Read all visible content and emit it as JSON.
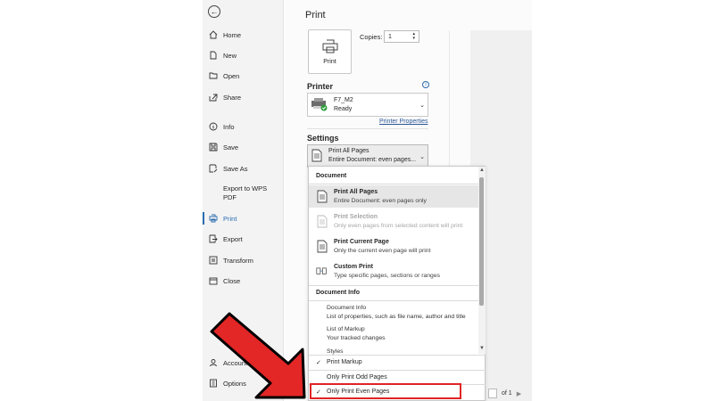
{
  "sidebar": {
    "back_label": "←",
    "items": [
      {
        "label": "Home",
        "icon": "home-icon"
      },
      {
        "label": "New",
        "icon": "new-doc-icon"
      },
      {
        "label": "Open",
        "icon": "folder-icon"
      },
      {
        "label": "Share",
        "icon": "share-icon"
      },
      {
        "label": "Info",
        "icon": "info-icon"
      },
      {
        "label": "Save",
        "icon": "save-icon"
      },
      {
        "label": "Save As",
        "icon": "save-as-icon"
      },
      {
        "label": "Export to WPS PDF",
        "line1": "Export to WPS",
        "line2": "PDF",
        "icon": ""
      },
      {
        "label": "Print",
        "icon": "printer-icon"
      },
      {
        "label": "Export",
        "icon": "export-icon"
      },
      {
        "label": "Transform",
        "icon": "transform-icon"
      },
      {
        "label": "Close",
        "icon": "close-icon"
      },
      {
        "label": "Account",
        "icon": "account-icon"
      },
      {
        "label": "Options",
        "icon": "options-icon"
      }
    ],
    "active": "Print"
  },
  "main": {
    "title": "Print",
    "print_button_label": "Print",
    "copies_label": "Copies:",
    "copies_value": "1",
    "printer_section": "Printer",
    "printer_name": "F7_M2",
    "printer_status": "Ready",
    "printer_properties_link": "Printer Properties",
    "settings_section": "Settings",
    "settings_line1": "Print All Pages",
    "settings_line2": "Entire Document: even pages..."
  },
  "dropdown": {
    "document_header": "Document",
    "items": [
      {
        "title": "Print All Pages",
        "desc": "Entire Document: even pages only",
        "selected": true,
        "disabled": false
      },
      {
        "title": "Print Selection",
        "desc": "Only even pages from selected content will print",
        "selected": false,
        "disabled": true
      },
      {
        "title": "Print Current Page",
        "desc": "Only the current even page will print",
        "selected": false,
        "disabled": false
      },
      {
        "title": "Custom Print",
        "desc": "Type specific pages, sections or ranges",
        "selected": false,
        "disabled": false
      }
    ],
    "docinfo_header": "Document Info",
    "docinfo_items": [
      {
        "title": "Document Info",
        "desc": "List of properties, such as file name, author and title"
      },
      {
        "title": "List of Markup",
        "desc": "Your tracked changes"
      },
      {
        "title": "Styles",
        "desc": ""
      }
    ],
    "check_items": [
      {
        "label": "Print Markup",
        "checked": true
      },
      {
        "label": "Only Print Odd Pages",
        "checked": false
      },
      {
        "label": "Only Print Even Pages",
        "checked": true
      }
    ]
  },
  "pager": {
    "of_label": "of 1"
  },
  "colors": {
    "highlight": "#e02424",
    "arrow": "#e32626",
    "link": "#2b5797",
    "active_bar": "#2b6cb0"
  }
}
